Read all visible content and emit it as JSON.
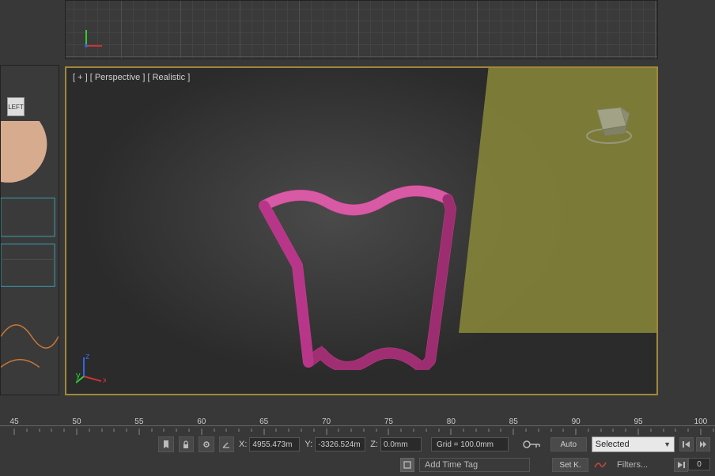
{
  "viewport": {
    "plus": "[ + ]",
    "view": "[ Perspective ]",
    "shading": "[ Realistic ]",
    "left_label": "LEFT"
  },
  "axes": {
    "x": "x",
    "y": "y",
    "z": "z"
  },
  "coords": {
    "x_label": "X:",
    "x_value": "4955.473m",
    "y_label": "Y:",
    "y_value": "-3326.524m",
    "z_label": "Z:",
    "z_value": "0.0mm"
  },
  "grid": {
    "readout": "Grid = 100.0mm"
  },
  "key": {
    "auto": "Auto",
    "setk": "Set K.",
    "selected": "Selected",
    "filters": "Filters..."
  },
  "time_tag": {
    "add": "Add Time Tag"
  },
  "timeline": {
    "ticks": [
      45,
      50,
      55,
      60,
      65,
      70,
      75,
      80,
      85,
      90,
      95,
      100
    ],
    "frame": "0"
  },
  "icons": {
    "bookmark": "bookmark-icon",
    "lock": "lock-icon",
    "snap": "snap-icon",
    "snap2": "snap-angle-icon",
    "key": "key-icon",
    "tag": "tag-icon",
    "curve": "curve-icon",
    "prev_key": "prev-key-icon",
    "play": "play-icon",
    "next_key": "next-key-icon",
    "end": "goto-end-icon"
  },
  "colors": {
    "accent_border": "#a08838",
    "shape_fill": "#c23e8a",
    "ground": "#8a8a3a"
  }
}
